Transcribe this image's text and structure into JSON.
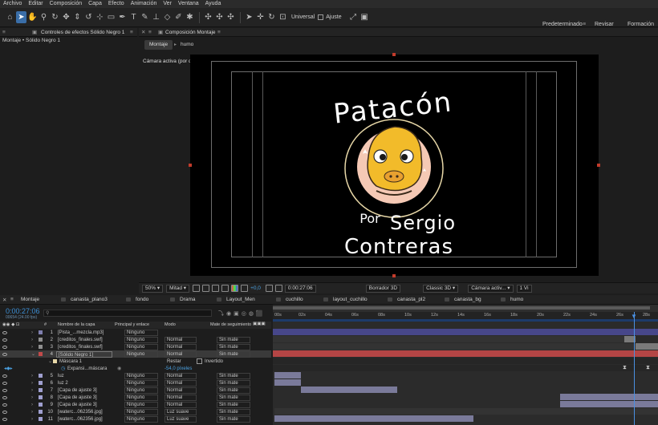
{
  "menu": [
    "Archivo",
    "Editar",
    "Composición",
    "Capa",
    "Efecto",
    "Animación",
    "Ver",
    "Ventana",
    "Ayuda"
  ],
  "toolbar": {
    "universal_label": "Universal",
    "ajuste_label": "Ajuste"
  },
  "workspaces": [
    "Predeterminado",
    "Revisar",
    "Formación"
  ],
  "left_panel": {
    "tab": "Controles de efectos Sólido Negro 1",
    "path": "Montaje • Sólido Negro 1"
  },
  "comp_panel": {
    "tab": "Composición Montaje",
    "sub_tabs": [
      "Montaje",
      "humo"
    ],
    "camera_label": "Cámara activa (por defecto)",
    "footer": {
      "zoom": "50%",
      "resolution": "Mitad",
      "plus_value": "+0,0",
      "timecode": "0:00:27:06",
      "renderer": "Borrador 3D",
      "classic": "Classic 3D",
      "camera": "Cámara activ...",
      "views": "1 Vi"
    }
  },
  "artwork": {
    "title": "Patacón",
    "by": "Por",
    "name1": "Sergio",
    "name2": "Contreras"
  },
  "timeline": {
    "tabs": [
      "Montaje",
      "canasta_plano3",
      "fondo",
      "Drama",
      "Layout_Men",
      "cuchillo",
      "layout_cuchillo",
      "canasta_pl2",
      "canasta_bg",
      "humo"
    ],
    "timecode": "0:00:27:06",
    "frames": "00654 (24.00 fps)",
    "columns": {
      "num": "#",
      "name": "Nombre de la capa",
      "parent": "Principal y enlace",
      "mode": "Modo",
      "matte": "Mate de seguimiento"
    },
    "ruler": [
      "00s",
      "02s",
      "04s",
      "06s",
      "08s",
      "10s",
      "12s",
      "14s",
      "16s",
      "18s",
      "20s",
      "22s",
      "24s",
      "26s",
      "28s"
    ],
    "layers": [
      {
        "num": "1",
        "name": "[Pista_...mezcla.mp3]",
        "parent": "Ninguno",
        "mode": "",
        "matte": "",
        "color": "#7f7faf"
      },
      {
        "num": "2",
        "name": "[creditos_finales.swf]",
        "parent": "Ninguno",
        "mode": "Normal",
        "matte": "Sin mate",
        "color": "#8f8f8f"
      },
      {
        "num": "3",
        "name": "[creditos_finales.swf]",
        "parent": "Ninguno",
        "mode": "Normal",
        "matte": "Sin mate",
        "color": "#8f8f8f"
      },
      {
        "num": "4",
        "name": "[Sólido Negro 1]",
        "parent": "Ninguno",
        "mode": "Normal",
        "matte": "Sin mate",
        "color": "#c24a4a"
      },
      {
        "num": "5",
        "name": "luz",
        "parent": "Ninguno",
        "mode": "Normal",
        "matte": "Sin mate",
        "color": "#9f9fcf"
      },
      {
        "num": "6",
        "name": "luz 2",
        "parent": "Ninguno",
        "mode": "Normal",
        "matte": "Sin mate",
        "color": "#9f9fcf"
      },
      {
        "num": "7",
        "name": "[Capa de ajuste 3]",
        "parent": "Ninguno",
        "mode": "Normal",
        "matte": "Sin mate",
        "color": "#9f9fcf"
      },
      {
        "num": "8",
        "name": "[Capa de ajuste 3]",
        "parent": "Ninguno",
        "mode": "Normal",
        "matte": "Sin mate",
        "color": "#9f9fcf"
      },
      {
        "num": "9",
        "name": "[Capa de ajuste 3]",
        "parent": "Ninguno",
        "mode": "Normal",
        "matte": "Sin mate",
        "color": "#9f9fcf"
      },
      {
        "num": "10",
        "name": "[waterc...062356.jpg]",
        "parent": "Ninguno",
        "mode": "Luz suave",
        "matte": "Sin mate",
        "color": "#9f9fcf"
      },
      {
        "num": "11",
        "name": "[waterc...062356.jpg]",
        "parent": "Ninguno",
        "mode": "Luz suave",
        "matte": "Sin mate",
        "color": "#9f9fcf"
      }
    ],
    "mask": {
      "label": "Máscara 1",
      "mode": "Restar",
      "inverted": "Invertido",
      "expansion_label": "Expansi...máscara",
      "expansion_value": "-54,0 píxeles"
    }
  },
  "colors": {
    "accent": "#3a6ea8",
    "timecode": "#3d8fd6",
    "layer4_bar": "#b44545",
    "video_bar": "#7a7a9a",
    "audio_bar": "#47478a"
  }
}
